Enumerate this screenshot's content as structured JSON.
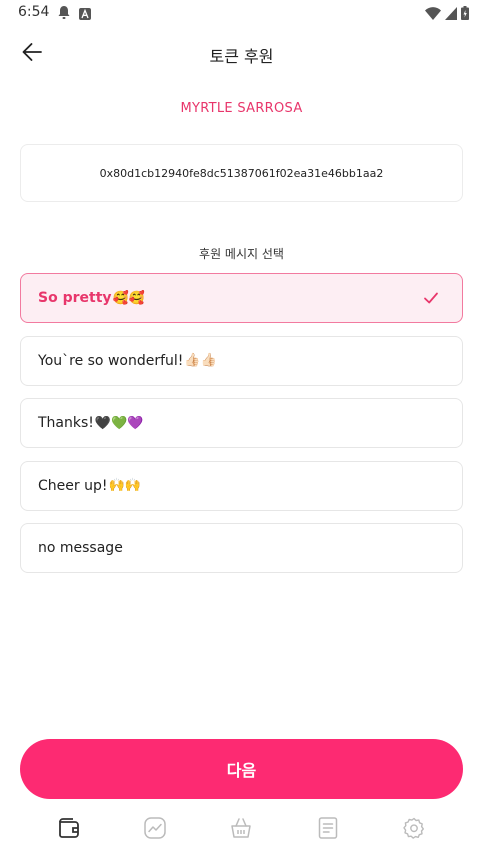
{
  "status_bar": {
    "time": "6:54",
    "left_icons": [
      "notification-bell-icon",
      "app-a-icon"
    ],
    "right_icons": [
      "wifi-icon",
      "cell-signal-icon",
      "battery-icon"
    ]
  },
  "header": {
    "title": "토큰 후원",
    "back_icon": "arrow-left-icon"
  },
  "recipient": {
    "name": "MYRTLE SARROSA"
  },
  "wallet": {
    "address": "0x80d1cb12940fe8dc51387061f02ea31e46bb1aa2"
  },
  "messages": {
    "section_label": "후원 메시지 선택",
    "items": [
      {
        "text": "So pretty",
        "emoji": "🥰🥰",
        "selected": true
      },
      {
        "text": "You`re so wonderful!",
        "emoji": "👍🏻👍🏻",
        "selected": false
      },
      {
        "text": "Thanks!",
        "emoji": "🖤💚💜",
        "selected": false
      },
      {
        "text": "Cheer up!",
        "emoji": "🙌🙌",
        "selected": false
      },
      {
        "text": "no message",
        "emoji": "",
        "selected": false
      }
    ]
  },
  "actions": {
    "next_label": "다음"
  },
  "bottom_nav": {
    "items": [
      "wallet-icon",
      "chart-icon",
      "shop-basket-icon",
      "document-icon",
      "settings-gear-icon"
    ],
    "active_index": 0
  },
  "colors": {
    "accent": "#fd2a72",
    "accent_text": "#e8366b",
    "selected_bg": "#fdeef3",
    "selected_border": "#f27a9f"
  }
}
